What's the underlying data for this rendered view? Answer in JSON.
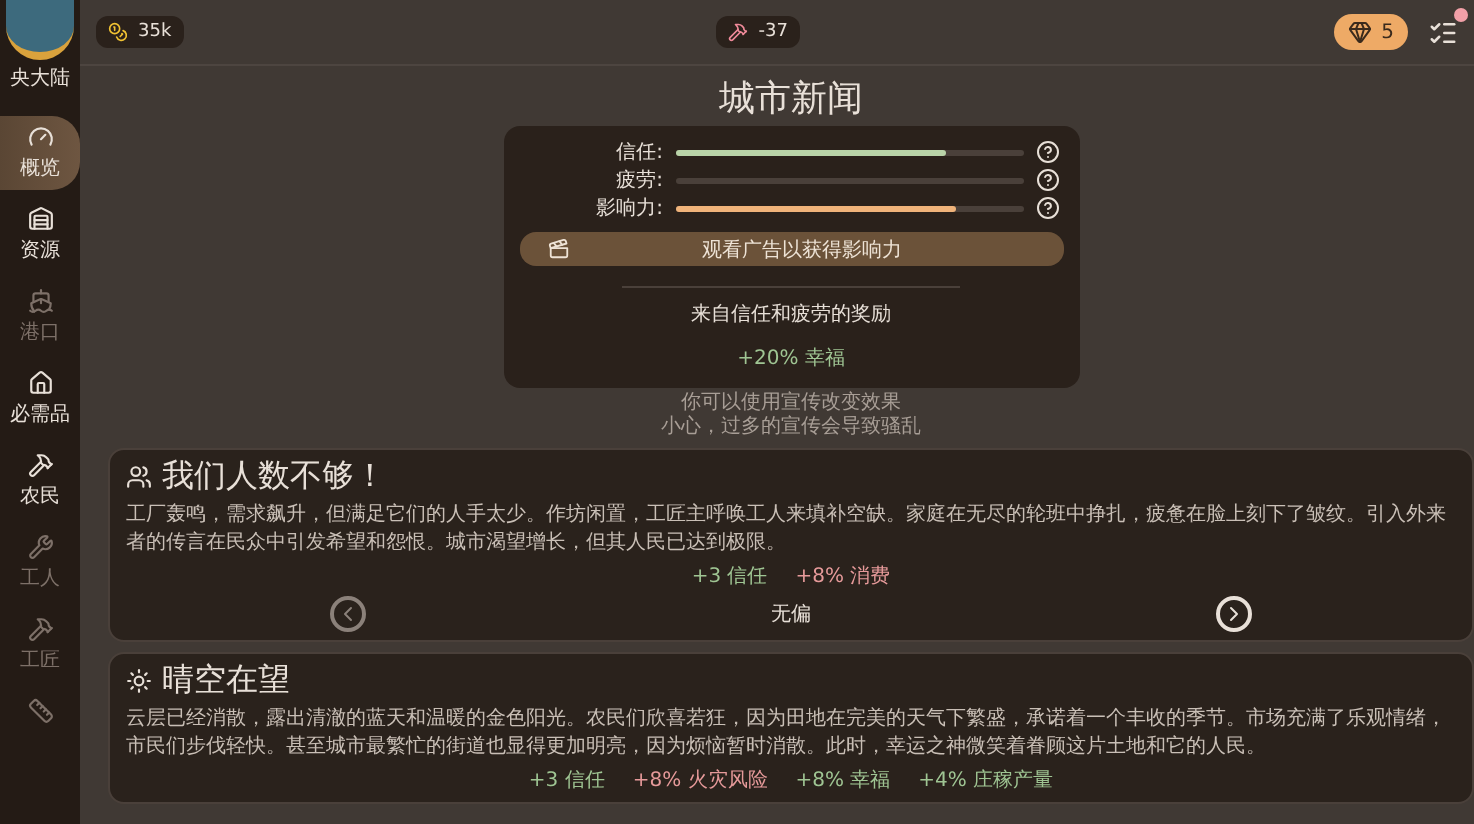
{
  "sidebar": {
    "region_name": "央大陆",
    "items": [
      {
        "label": "概览",
        "selected": true,
        "disabled": false
      },
      {
        "label": "资源",
        "selected": false,
        "disabled": false
      },
      {
        "label": "港口",
        "selected": false,
        "disabled": true
      },
      {
        "label": "必需品",
        "selected": false,
        "disabled": false
      },
      {
        "label": "农民",
        "selected": false,
        "disabled": false
      },
      {
        "label": "工人",
        "selected": false,
        "disabled": true
      },
      {
        "label": "工匠",
        "selected": false,
        "disabled": true
      },
      {
        "selected": false,
        "disabled": true
      }
    ]
  },
  "topbar": {
    "coins": "35k",
    "workforce": "-37",
    "gems": "5"
  },
  "news": {
    "title": "城市新闻",
    "meters": [
      {
        "label": "信任:",
        "level": 0.78,
        "color": "#b9d3a8"
      },
      {
        "label": "疲劳:",
        "level": 0
      },
      {
        "label": "影响力:",
        "level": 0.81,
        "color": "#f0b37a"
      }
    ],
    "ad_button": "观看广告以获得影响力",
    "bonus_title": "来自信任和疲劳的奖励",
    "bonus": "+20% 幸福",
    "notes": [
      "你可以使用宣传改变效果",
      "小心，过多的宣传会导致骚乱"
    ]
  },
  "events": [
    {
      "title": "我们人数不够！",
      "text": "工厂轰鸣，需求飙升，但满足它们的人手太少。作坊闲置，工匠主呼唤工人来填补空缺。家庭在无尽的轮班中挣扎，疲惫在脸上刻下了皱纹。引入外来者的传言在民众中引发希望和怨恨。城市渴望增长，但其人民已达到极限。",
      "effects": [
        {
          "text": "+3 信任",
          "kind": "good"
        },
        {
          "text": "+8% 消费",
          "kind": "bad"
        }
      ],
      "choice": "无偏"
    },
    {
      "title": "晴空在望",
      "text": "云层已经消散，露出清澈的蓝天和温暖的金色阳光。农民们欣喜若狂，因为田地在完美的天气下繁盛，承诺着一个丰收的季节。市场充满了乐观情绪，市民们步伐轻快。甚至城市最繁忙的街道也显得更加明亮，因为烦恼暂时消散。此时，幸运之神微笑着眷顾这片土地和它的人民。",
      "effects": [
        {
          "text": "+3 信任",
          "kind": "good"
        },
        {
          "text": "+8% 火灾风险",
          "kind": "bad"
        },
        {
          "text": "+8% 幸福",
          "kind": "good"
        },
        {
          "text": "+4% 庄稼产量",
          "kind": "good"
        }
      ]
    }
  ]
}
